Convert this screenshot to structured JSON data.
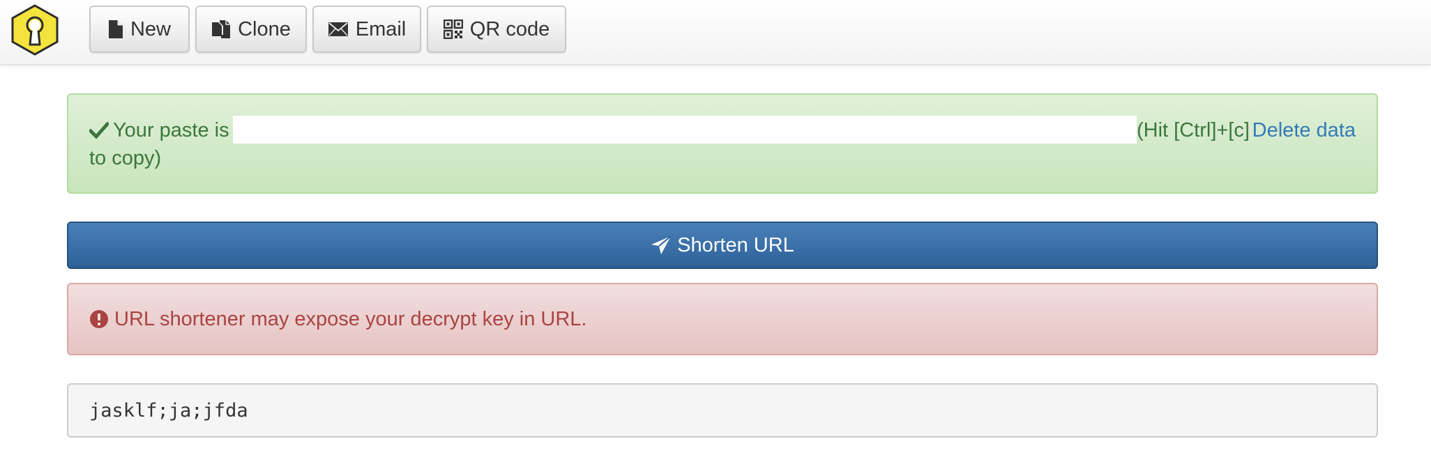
{
  "toolbar": {
    "new_label": "New",
    "clone_label": "Clone",
    "email_label": "Email",
    "qr_label": "QR code"
  },
  "success_alert": {
    "prefix": "Your paste is",
    "url_value": "",
    "hint_part1": "(Hit [Ctrl]+[c]",
    "hint_part2": "to copy)",
    "delete_label": "Delete data"
  },
  "shorten_button": {
    "label": "Shorten URL"
  },
  "danger_alert": {
    "text": "URL shortener may expose your decrypt key in URL."
  },
  "paste": {
    "content": "jasklf;ja;jfda"
  },
  "icons": {
    "logo": "keyhole-icon",
    "new": "file-icon",
    "clone": "duplicate-icon",
    "email": "envelope-icon",
    "qr": "qrcode-icon",
    "success": "checkmark-icon",
    "shorten": "send-icon",
    "danger": "exclamation-circle-icon"
  },
  "colors": {
    "success_text": "#3c763d",
    "link": "#337ab7",
    "primary": "#337ab7",
    "danger_text": "#a94442",
    "logo_fill": "#f5e33d"
  }
}
